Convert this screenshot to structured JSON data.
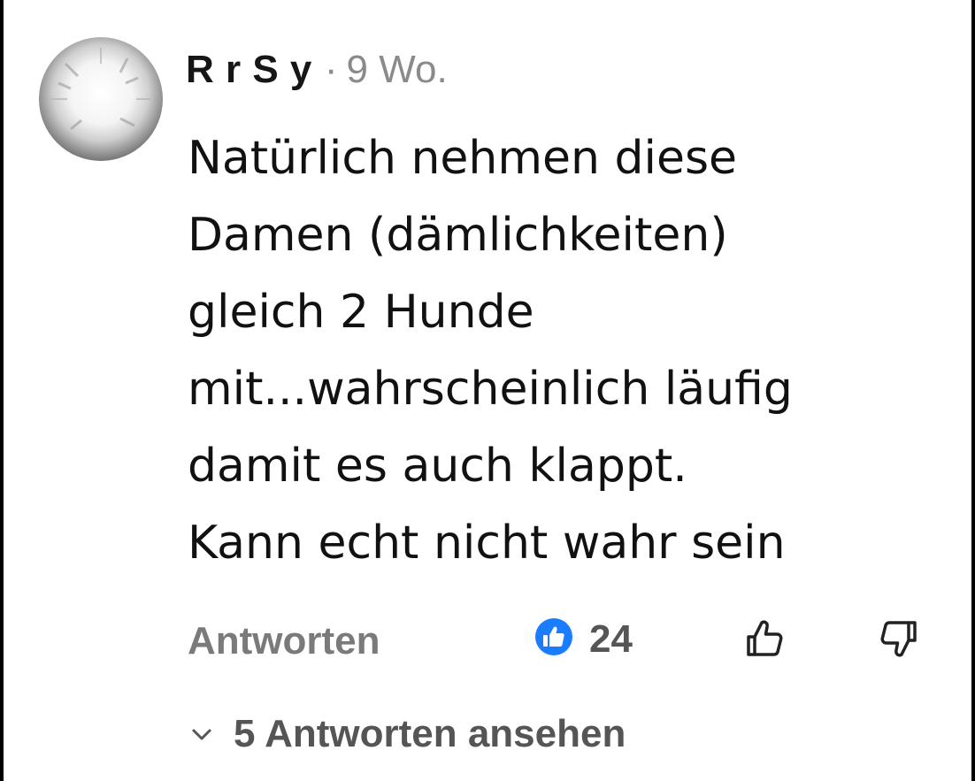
{
  "comment": {
    "author": "R    r S    y",
    "separator": "·",
    "time_ago": "9 Wo.",
    "text_lines": [
      "Natürlich nehmen diese",
      "Damen (dämlichkeiten)",
      "gleich 2 Hunde",
      "mit...wahrscheinlich läufig",
      "damit es auch klappt.",
      "Kann echt nicht wahr sein"
    ]
  },
  "actions": {
    "reply_label": "Antworten",
    "like_count": "24",
    "like_badge_icon": "thumbs-up-filled-icon",
    "like_icon": "thumbs-up-outline-icon",
    "dislike_icon": "thumbs-down-outline-icon"
  },
  "replies": {
    "toggle_icon": "chevron-down-icon",
    "label": "5 Antworten ansehen"
  },
  "colors": {
    "text_primary": "#111111",
    "text_muted": "#8a8a8a",
    "action_gray": "#7a7a7a",
    "like_blue": "#1a7cff"
  }
}
